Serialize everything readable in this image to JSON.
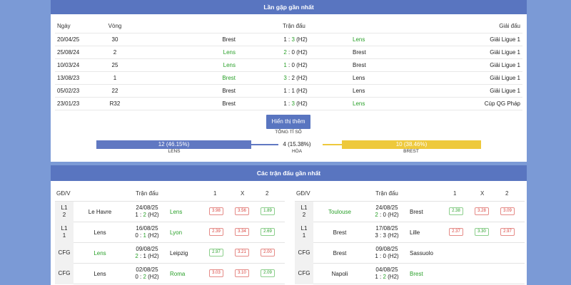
{
  "h2h": {
    "title": "Lần gặp gần nhất",
    "headers": {
      "date": "Ngày",
      "round": "Vòng",
      "match": "Trận đấu",
      "league": "Giải đấu"
    },
    "rows": [
      {
        "date": "20/04/25",
        "round": "30",
        "home": "Brest",
        "hs": "1",
        "as": "3",
        "note": "(H2)",
        "away": "Lens",
        "winner": "away",
        "league": "Giải Ligue 1"
      },
      {
        "date": "25/08/24",
        "round": "2",
        "home": "Lens",
        "hs": "2",
        "as": "0",
        "note": "(H2)",
        "away": "Brest",
        "winner": "home",
        "league": "Giải Ligue 1"
      },
      {
        "date": "10/03/24",
        "round": "25",
        "home": "Lens",
        "hs": "1",
        "as": "0",
        "note": "(H2)",
        "away": "Brest",
        "winner": "home",
        "league": "Giải Ligue 1"
      },
      {
        "date": "13/08/23",
        "round": "1",
        "home": "Brest",
        "hs": "3",
        "as": "2",
        "note": "(H2)",
        "away": "Lens",
        "winner": "home",
        "league": "Giải Ligue 1"
      },
      {
        "date": "05/02/23",
        "round": "22",
        "home": "Brest",
        "hs": "1",
        "as": "1",
        "note": "(H2)",
        "away": "Lens",
        "winner": "draw",
        "league": "Giải Ligue 1"
      },
      {
        "date": "23/01/23",
        "round": "R32",
        "home": "Brest",
        "hs": "1",
        "as": "3",
        "note": "(H2)",
        "away": "Lens",
        "winner": "away",
        "league": "Cúp QG Pháp"
      }
    ],
    "more_button": "Hiển thị thêm",
    "total_label": "TỔNG TỈ SỐ",
    "lens_bar": "12 (46.15%)",
    "lens_label": "LENS",
    "draw_value": "4 (15.38%)",
    "draw_label": "HÒA",
    "brest_bar": "10 (38.46%)",
    "brest_label": "BREST"
  },
  "recent": {
    "title": "Các trận đấu gần nhất",
    "headers": {
      "comp": "GĐ/V",
      "match": "Trận đấu",
      "o1": "1",
      "ox": "X",
      "o2": "2"
    },
    "left": [
      {
        "comp1": "L1",
        "comp2": "2",
        "home": "Le Havre",
        "home_win": false,
        "date": "24/08/25",
        "hs": "1",
        "as": "2",
        "note": "(H2)",
        "away": "Lens",
        "away_win": true,
        "o1": "3.98",
        "o1c": "red",
        "ox": "3.56",
        "oxc": "red",
        "o2": "1.89",
        "o2c": "green"
      },
      {
        "comp1": "L1",
        "comp2": "1",
        "home": "Lens",
        "home_win": false,
        "date": "16/08/25",
        "hs": "0",
        "as": "1",
        "note": "(H2)",
        "away": "Lyon",
        "away_win": true,
        "o1": "2.39",
        "o1c": "red",
        "ox": "3.34",
        "oxc": "red",
        "o2": "2.69",
        "o2c": "green"
      },
      {
        "comp1": "CFG",
        "comp2": "",
        "home": "Lens",
        "home_win": true,
        "date": "09/08/25",
        "hs": "2",
        "as": "1",
        "note": "(H2)",
        "away": "Leipzig",
        "away_win": false,
        "o1": "2.97",
        "o1c": "green",
        "ox": "3.21",
        "oxc": "red",
        "o2": "2.00",
        "o2c": "red"
      },
      {
        "comp1": "CFG",
        "comp2": "",
        "home": "Lens",
        "home_win": false,
        "date": "02/08/25",
        "hs": "0",
        "as": "2",
        "note": "(H2)",
        "away": "Roma",
        "away_win": true,
        "o1": "3.03",
        "o1c": "red",
        "ox": "3.10",
        "oxc": "red",
        "o2": "2.09",
        "o2c": "green"
      }
    ],
    "right": [
      {
        "comp1": "L1",
        "comp2": "2",
        "home": "Toulouse",
        "home_win": true,
        "date": "24/08/25",
        "hs": "2",
        "as": "0",
        "note": "(H2)",
        "away": "Brest",
        "away_win": false,
        "o1": "2.38",
        "o1c": "green",
        "ox": "3.28",
        "oxc": "red",
        "o2": "3.09",
        "o2c": "red"
      },
      {
        "comp1": "L1",
        "comp2": "1",
        "home": "Brest",
        "home_win": false,
        "date": "17/08/25",
        "hs": "3",
        "as": "3",
        "note": "(H2)",
        "away": "Lille",
        "away_win": false,
        "o1": "2.37",
        "o1c": "red",
        "ox": "3.30",
        "oxc": "green",
        "o2": "2.97",
        "o2c": "red"
      },
      {
        "comp1": "CFG",
        "comp2": "",
        "home": "Brest",
        "home_win": false,
        "date": "09/08/25",
        "hs": "1",
        "as": "0",
        "note": "(H2)",
        "away": "Sassuolo",
        "away_win": false,
        "o1": "",
        "o1c": "",
        "ox": "",
        "oxc": "",
        "o2": "",
        "o2c": ""
      },
      {
        "comp1": "CFG",
        "comp2": "",
        "home": "Napoli",
        "home_win": false,
        "date": "04/08/25",
        "hs": "1",
        "as": "2",
        "note": "(H2)",
        "away": "Brest",
        "away_win": true,
        "o1": "",
        "o1c": "",
        "ox": "",
        "oxc": "",
        "o2": "",
        "o2c": ""
      }
    ]
  },
  "colors": {
    "header_blue": "#5975c0",
    "background": "#7b9ad6",
    "win_green": "#2aa02a",
    "lens_bar": "#6078c2",
    "brest_bar": "#eec93c",
    "odds_red": "#d9403a"
  }
}
